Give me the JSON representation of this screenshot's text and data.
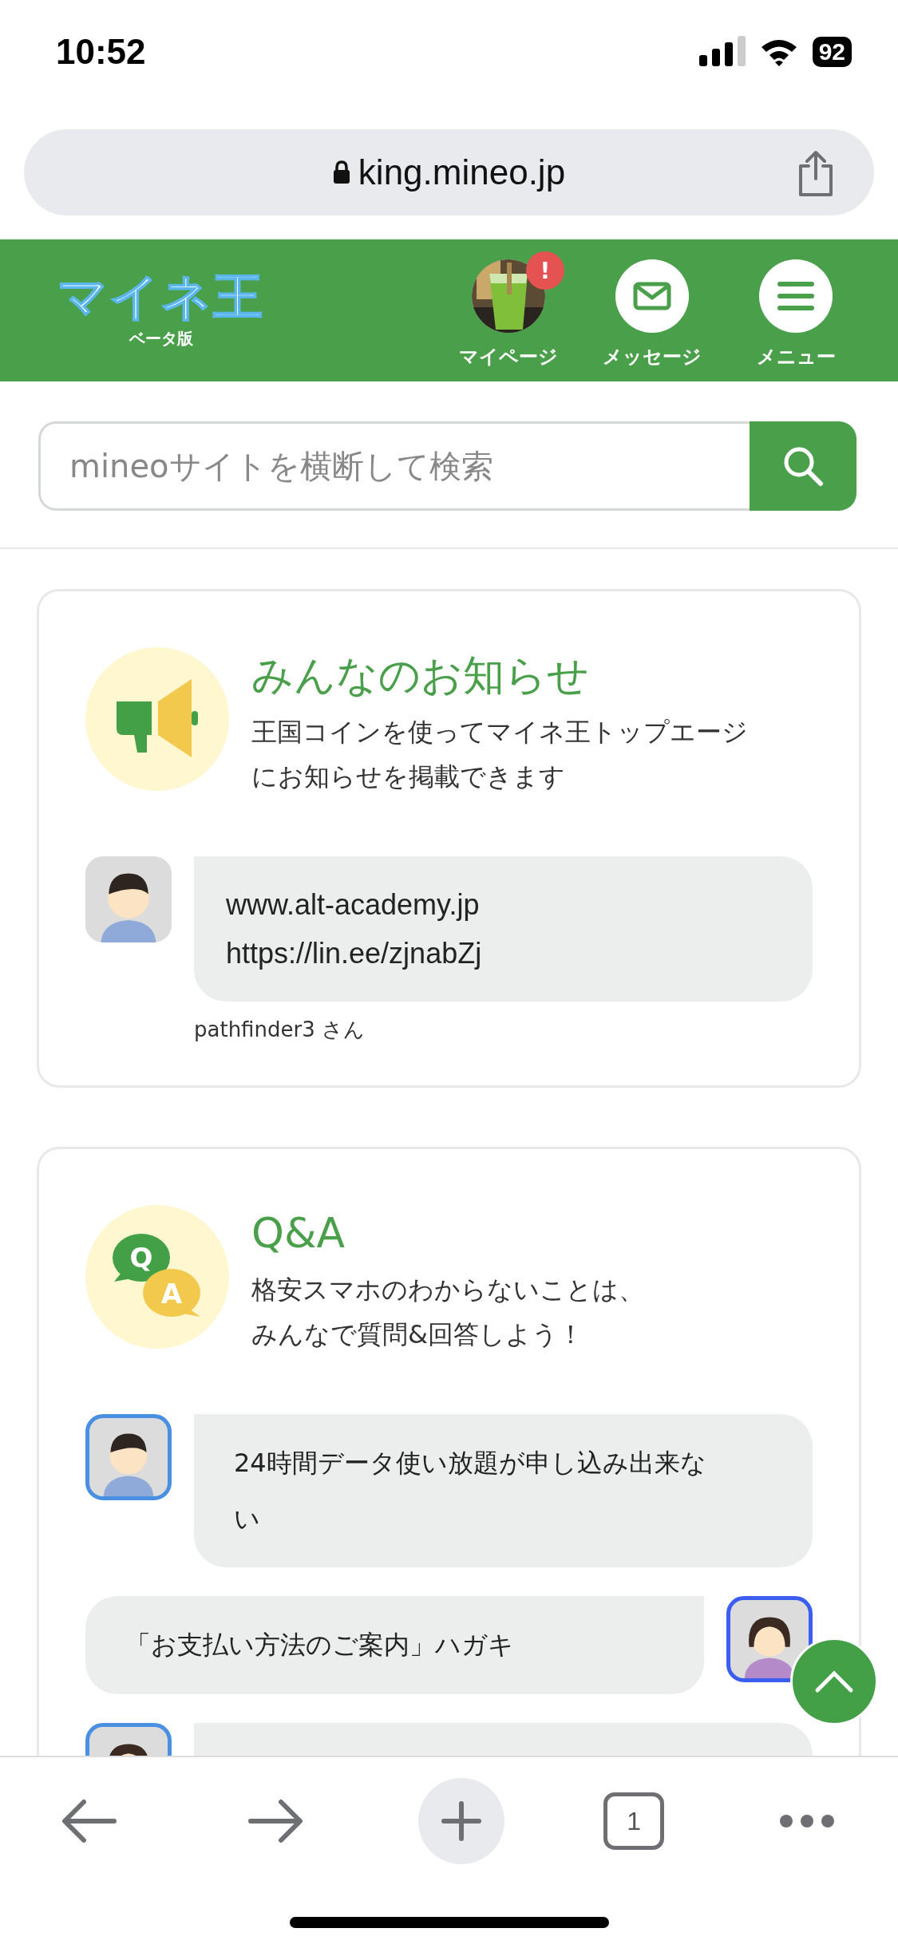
{
  "status_bar": {
    "time": "10:52",
    "battery": "92"
  },
  "browser": {
    "url": "king.mineo.jp",
    "tab_count": "1"
  },
  "header": {
    "logo": "マイネ王",
    "logo_sub": "ベータ版",
    "nav": [
      {
        "label": "マイページ",
        "kind": "profile",
        "alert": "!"
      },
      {
        "label": "メッセージ",
        "kind": "mail"
      },
      {
        "label": "メニュー",
        "kind": "menu"
      }
    ]
  },
  "search": {
    "placeholder": "mineoサイトを横断して検索"
  },
  "cards": [
    {
      "title": "みんなのお知らせ",
      "kind": "megaphone",
      "description": [
        "王国コインを使ってマイネ王トップエージ",
        "にお知らせを掲載できます"
      ],
      "posts": [
        {
          "kind": "left",
          "bordered": false,
          "lines": [
            "www.alt-academy.jp",
            "https://lin.ee/zjnabZj"
          ],
          "author": "pathfinder3 さん"
        }
      ]
    },
    {
      "title": "Q&A",
      "kind": "qa",
      "icon_letters": [
        "Q",
        "A"
      ],
      "description": [
        "格安スマホのわからないことは、",
        "みんなで質問&回答しよう！"
      ],
      "posts": [
        {
          "kind": "left",
          "bordered": true,
          "lines": [
            "24時間データ使い放題が申し込み出来な",
            "い"
          ]
        },
        {
          "kind": "right",
          "bordered": true,
          "lines": [
            "「お支払い方法のご案内」ハガキ"
          ]
        },
        {
          "kind": "left",
          "bordered": true
        }
      ]
    }
  ]
}
